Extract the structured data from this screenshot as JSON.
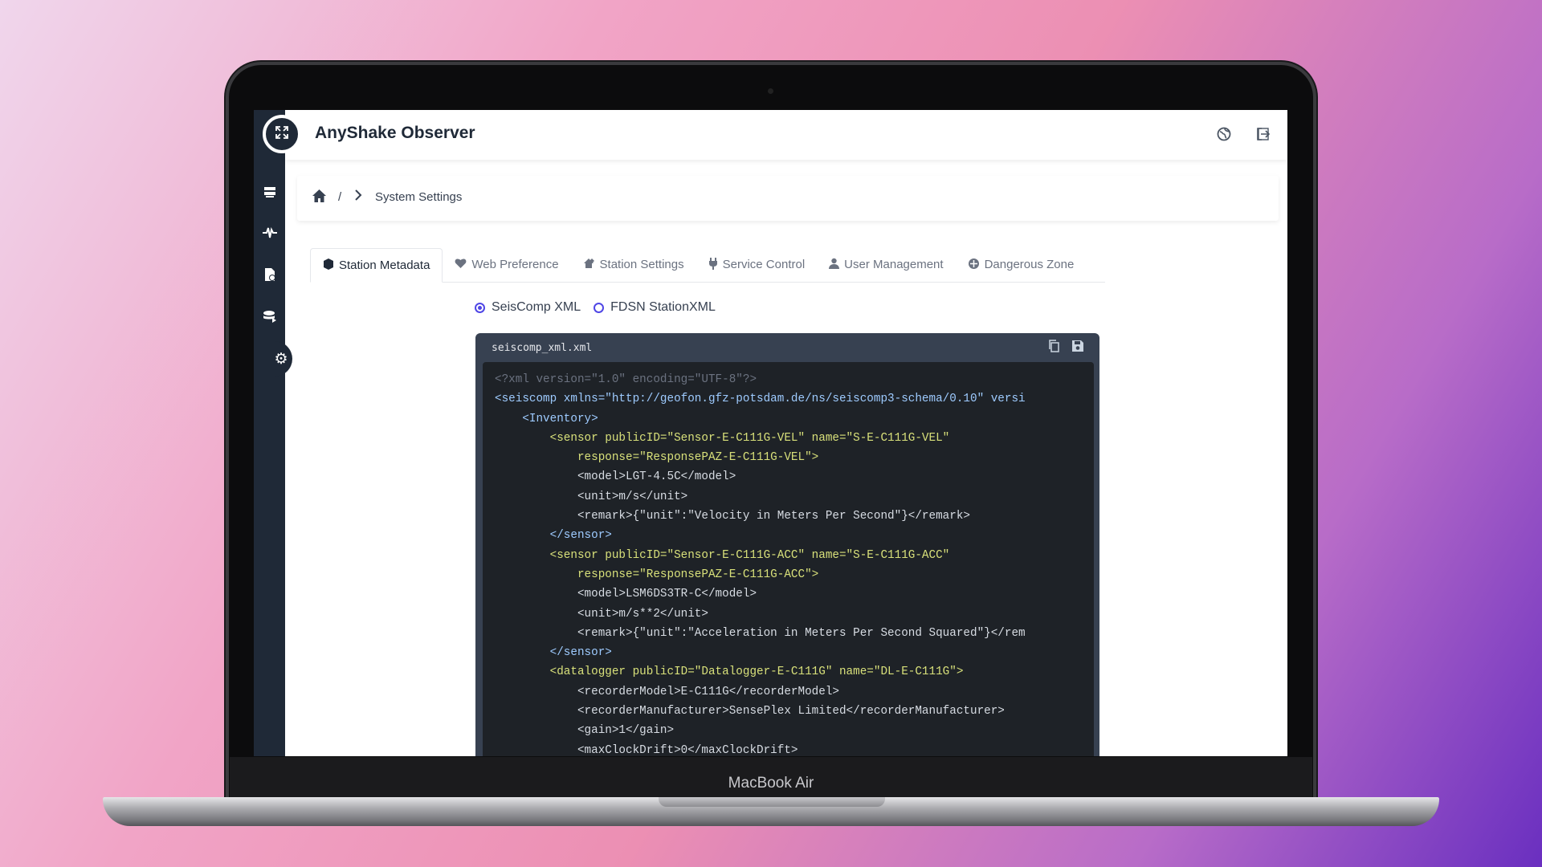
{
  "device": {
    "label": "MacBook Air"
  },
  "app": {
    "title": "AnyShake Observer",
    "logo_icon": "expand-icon"
  },
  "topbar": {
    "language_icon": "globe-icon",
    "logout_icon": "logout-icon"
  },
  "sidebar": {
    "items": [
      {
        "name": "servers",
        "icon": "server-icon"
      },
      {
        "name": "waveform",
        "icon": "wave-icon"
      },
      {
        "name": "history",
        "icon": "file-clock-icon"
      },
      {
        "name": "export",
        "icon": "database-icon"
      },
      {
        "name": "settings",
        "icon": "gear-icon",
        "active": true
      }
    ]
  },
  "breadcrumb": {
    "home_icon": "home-icon",
    "separator": "/",
    "current": "System Settings"
  },
  "tabs": [
    {
      "label": "Station Metadata",
      "icon": "cube-icon",
      "active": true
    },
    {
      "label": "Web Preference",
      "icon": "heart-icon"
    },
    {
      "label": "Station Settings",
      "icon": "home-pen-icon"
    },
    {
      "label": "Service Control",
      "icon": "plug-icon"
    },
    {
      "label": "User Management",
      "icon": "user-icon"
    },
    {
      "label": "Dangerous Zone",
      "icon": "bug-icon"
    }
  ],
  "format": {
    "options": [
      "SeisComp XML",
      "FDSN StationXML"
    ],
    "selected": "SeisComp XML"
  },
  "editor": {
    "filename": "seiscomp_xml.xml",
    "copy_icon": "copy-icon",
    "save_icon": "save-icon",
    "lines": [
      "<?xml version=\"1.0\" encoding=\"UTF-8\"?>",
      "<seiscomp xmlns=\"http://geofon.gfz-potsdam.de/ns/seiscomp3-schema/0.10\" versi",
      "    <Inventory>",
      "        <sensor publicID=\"Sensor-E-C111G-VEL\" name=\"S-E-C111G-VEL\"",
      "            response=\"ResponsePAZ-E-C111G-VEL\">",
      "            <model>LGT-4.5C</model>",
      "            <unit>m/s</unit>",
      "            <remark>{\"unit\":\"Velocity in Meters Per Second\"}</remark>",
      "        </sensor>",
      "        <sensor publicID=\"Sensor-E-C111G-ACC\" name=\"S-E-C111G-ACC\"",
      "            response=\"ResponsePAZ-E-C111G-ACC\">",
      "            <model>LSM6DS3TR-C</model>",
      "            <unit>m/s**2</unit>",
      "            <remark>{\"unit\":\"Acceleration in Meters Per Second Squared\"}</rem",
      "        </sensor>",
      "        <datalogger publicID=\"Datalogger-E-C111G\" name=\"DL-E-C111G\">",
      "            <recorderModel>E-C111G</recorderModel>",
      "            <recorderManufacturer>SensePlex Limited</recorderManufacturer>",
      "            <gain>1</gain>",
      "            <maxClockDrift>0</maxClockDrift>"
    ]
  }
}
